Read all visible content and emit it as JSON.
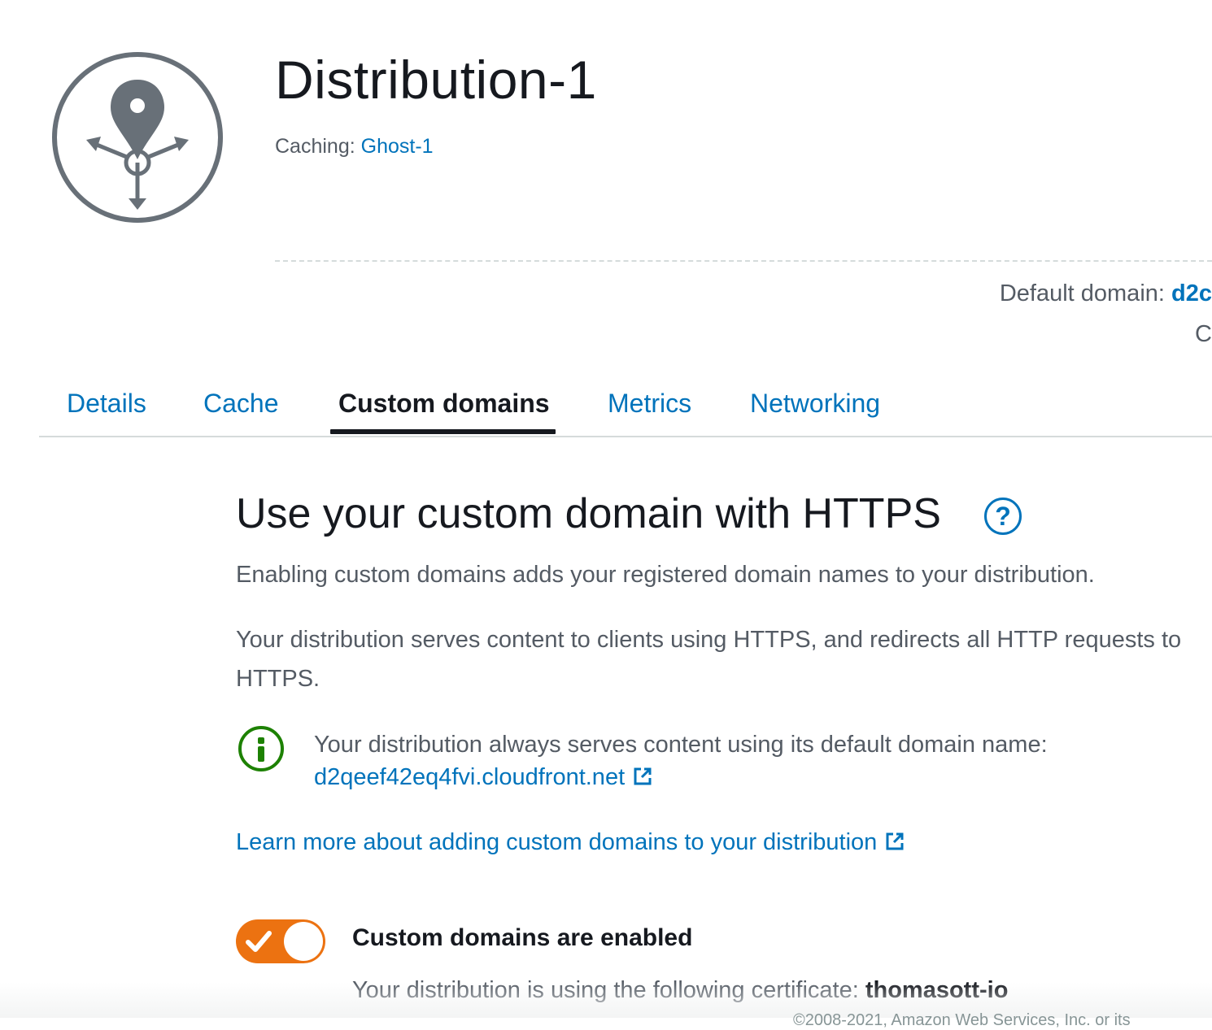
{
  "header": {
    "icon": "distribution-icon",
    "title": "Distribution-1",
    "caching_label": "Caching:",
    "caching_value": "Ghost-1",
    "default_domain_label": "Default domain:",
    "default_domain_value": "d2c",
    "cut_text": "C"
  },
  "tabs": [
    {
      "label": "Details",
      "active": false
    },
    {
      "label": "Cache",
      "active": false
    },
    {
      "label": "Custom domains",
      "active": true
    },
    {
      "label": "Metrics",
      "active": false
    },
    {
      "label": "Networking",
      "active": false
    }
  ],
  "section": {
    "heading": "Use your custom domain with HTTPS",
    "help_icon": "?",
    "paragraph1": "Enabling custom domains adds your registered domain names to your distribution.",
    "paragraph2": "Your distribution serves content to clients using HTTPS, and redirects all HTTP requests to HTTPS.",
    "info_text": "Your distribution always serves content using its default domain name:",
    "default_domain_link": "d2qeef42eq4fvi.cloudfront.net",
    "learn_more_link": "Learn more about adding custom domains to your distribution"
  },
  "toggle": {
    "enabled": true,
    "label": "Custom domains are enabled",
    "certificate_text": "Your distribution is using the following certificate:",
    "certificate_name": "thomasott-io"
  },
  "footer_fragment": "©2008-2021, Amazon Web Services, Inc. or its",
  "colors": {
    "link": "#0073bb",
    "text": "#16191f",
    "muted": "#545b64",
    "toggle_on": "#ec7211",
    "info": "#1d8102",
    "icon_gray": "#687078"
  }
}
